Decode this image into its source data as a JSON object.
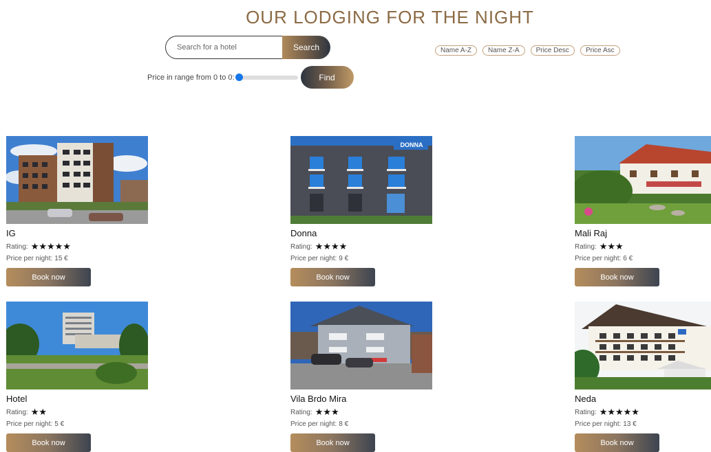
{
  "header": {
    "title": "OUR LODGING FOR THE NIGHT"
  },
  "search": {
    "placeholder": "Search for a hotel",
    "value": "",
    "button_label": "Search"
  },
  "sort_options": [
    "Name A-Z",
    "Name Z-A",
    "Price Desc",
    "Price Asc"
  ],
  "price_filter": {
    "label": "Price in range from 0 to 0:",
    "slider_value": 0,
    "button_label": "Find"
  },
  "colors": {
    "title": "#8b6a44",
    "accent_tan": "#b08a5a",
    "accent_dark": "#2d3540",
    "slider": "#1677e8"
  },
  "hotels": [
    {
      "name": "IG",
      "rating_label": "Rating:",
      "stars": "★★★★★",
      "rating": 5,
      "price_label": "Price per night:",
      "price": "15 €",
      "button_label": "Book now"
    },
    {
      "name": "Donna",
      "rating_label": "Rating:",
      "stars": "★★★★",
      "rating": 4,
      "price_label": "Price per night:",
      "price": "9 €",
      "button_label": "Book now",
      "sign_text": "DONNA"
    },
    {
      "name": "Mali Raj",
      "rating_label": "Rating:",
      "stars": "★★★",
      "rating": 3,
      "price_label": "Price per night:",
      "price": "6 €",
      "button_label": "Book now"
    },
    {
      "name": "Hotel",
      "rating_label": "Rating:",
      "stars": "★★",
      "rating": 2,
      "price_label": "Price per night:",
      "price": "5 €",
      "button_label": "Book now"
    },
    {
      "name": "Vila Brdo Mira",
      "rating_label": "Rating:",
      "stars": "★★★",
      "rating": 3,
      "price_label": "Price per night:",
      "price": "8 €",
      "button_label": "Book now"
    },
    {
      "name": "Neda",
      "rating_label": "Rating:",
      "stars": "★★★★★",
      "rating": 5,
      "price_label": "Price per night:",
      "price": "13 €",
      "button_label": "Book now"
    }
  ]
}
